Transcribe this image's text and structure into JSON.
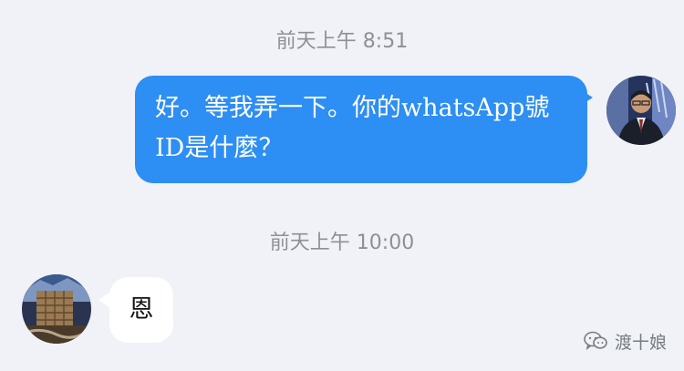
{
  "messages": [
    {
      "timestamp": "前天上午 8:51",
      "direction": "outgoing",
      "lines": [
        "好。等我弄一下。你的whatsApp號",
        "ID是什麼？"
      ],
      "bubble_color": "#2d8ef3"
    },
    {
      "timestamp": "前天上午 10:00",
      "direction": "incoming",
      "text": "恩",
      "bubble_color": "#ffffff"
    }
  ],
  "watermark": {
    "icon": "wechat-icon",
    "text": "渡十娘"
  },
  "colors": {
    "background": "#f0f2f7",
    "timestamp": "#8f8f94"
  }
}
